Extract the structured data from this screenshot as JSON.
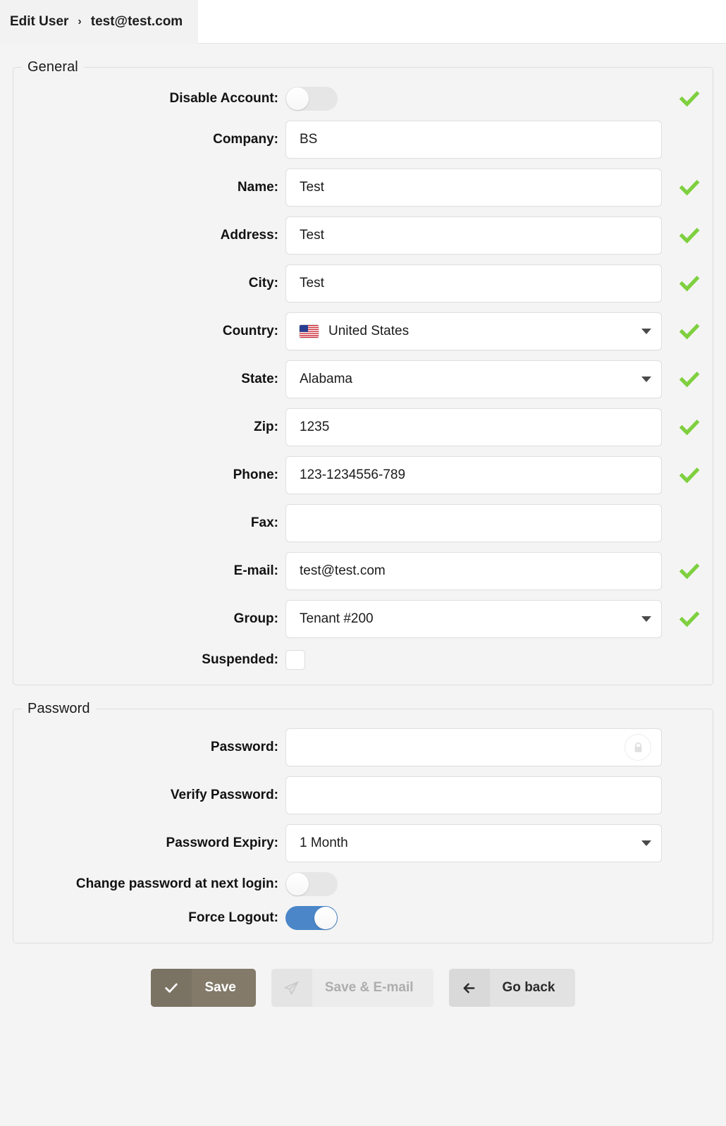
{
  "header": {
    "breadcrumb_root": "Edit User",
    "breadcrumb_separator": "›",
    "breadcrumb_current": "test@test.com"
  },
  "general": {
    "legend": "General",
    "fields": {
      "disable_account": {
        "label": "Disable Account:",
        "state": "off",
        "valid": true
      },
      "company": {
        "label": "Company:",
        "value": "BS",
        "valid": false
      },
      "name": {
        "label": "Name:",
        "value": "Test",
        "valid": true
      },
      "address": {
        "label": "Address:",
        "value": "Test",
        "valid": true
      },
      "city": {
        "label": "City:",
        "value": "Test",
        "valid": true
      },
      "country": {
        "label": "Country:",
        "value": "United States",
        "flag": "us-flag-icon",
        "valid": true
      },
      "state": {
        "label": "State:",
        "value": "Alabama",
        "valid": true
      },
      "zip": {
        "label": "Zip:",
        "value": "1235",
        "valid": true
      },
      "phone": {
        "label": "Phone:",
        "value": "123-1234556-789",
        "valid": true
      },
      "fax": {
        "label": "Fax:",
        "value": "",
        "valid": false
      },
      "email": {
        "label": "E-mail:",
        "value": "test@test.com",
        "valid": true
      },
      "group": {
        "label": "Group:",
        "value": "Tenant #200",
        "valid": true
      },
      "suspended": {
        "label": "Suspended:",
        "checked": false
      }
    }
  },
  "password": {
    "legend": "Password",
    "fields": {
      "password": {
        "label": "Password:",
        "value": "",
        "icon": "lock-icon"
      },
      "verify_password": {
        "label": "Verify Password:",
        "value": ""
      },
      "password_expiry": {
        "label": "Password Expiry:",
        "value": "1 Month"
      },
      "change_at_next_login": {
        "label": "Change password at next login:",
        "state": "off"
      },
      "force_logout": {
        "label": "Force Logout:",
        "state": "on"
      }
    }
  },
  "footer": {
    "save": {
      "label": "Save",
      "icon": "check-icon",
      "enabled": true
    },
    "save_email": {
      "label": "Save & E-mail",
      "icon": "paper-plane-icon",
      "enabled": false
    },
    "go_back": {
      "label": "Go back",
      "icon": "arrow-left-icon",
      "enabled": true
    }
  },
  "colors": {
    "toggle_on": "#4a86c8",
    "toggle_off": "#e6e6e6",
    "valid_check": "#7ed03f",
    "save_button": "#837a6a",
    "page_bg": "#f4f4f4"
  }
}
